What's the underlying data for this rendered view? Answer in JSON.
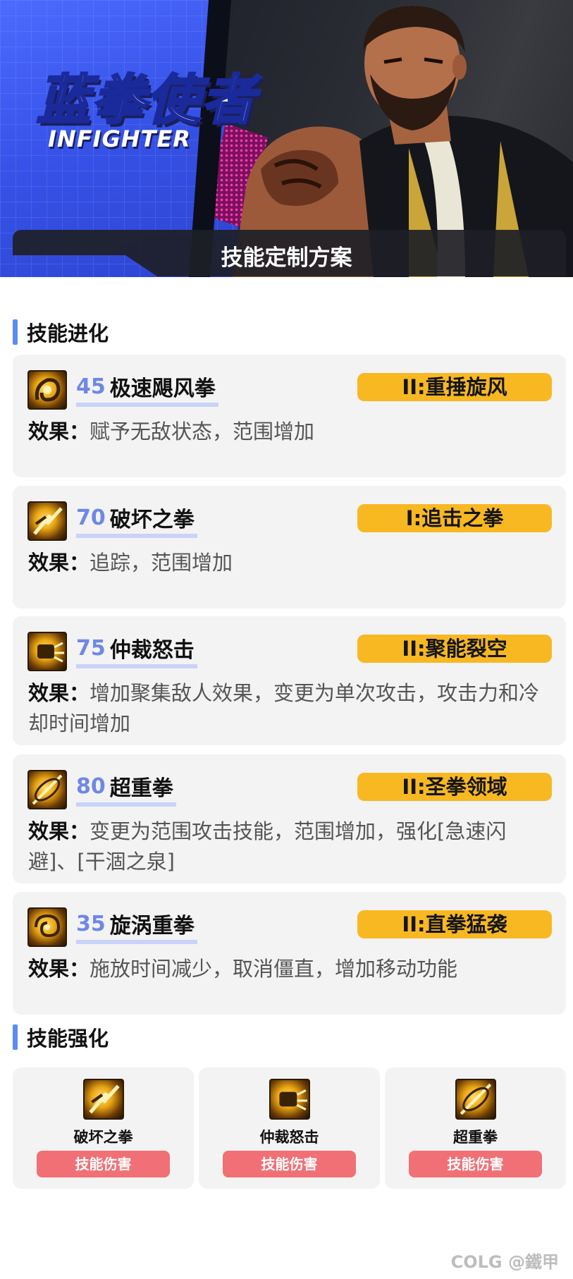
{
  "banner": {
    "title": "蓝拳使者",
    "subtitle": "INFIGHTER",
    "bar_title": "技能定制方案"
  },
  "sections": {
    "evolution": "技能进化",
    "enhance": "技能强化"
  },
  "effect_label": "效果：",
  "skills": [
    {
      "level": "45",
      "name": "极速飓风拳",
      "tag": "II:重捶旋风",
      "effect": "赋予无敌状态，范围增加",
      "icon": "whirlwind-fist-icon"
    },
    {
      "level": "70",
      "name": "破坏之拳",
      "tag": "I:追击之拳",
      "effect": "追踪，范围增加",
      "icon": "destruction-fist-icon"
    },
    {
      "level": "75",
      "name": "仲裁怒击",
      "tag": "II:聚能裂空",
      "effect": "增加聚集敌人效果，变更为单次攻击，攻击力和冷却时间增加",
      "icon": "arbitration-strike-icon"
    },
    {
      "level": "80",
      "name": "超重拳",
      "tag": "II:圣拳领域",
      "effect": "变更为范围攻击技能，范围增加，强化[急速闪避]、[干涸之泉]",
      "icon": "super-heavy-fist-icon"
    },
    {
      "level": "35",
      "name": "旋涡重拳",
      "tag": "II:直拳猛袭",
      "effect": "施放时间减少，取消僵直，增加移动功能",
      "icon": "vortex-fist-icon"
    }
  ],
  "enhancements": [
    {
      "name": "破坏之拳",
      "button": "技能伤害",
      "icon": "destruction-fist-icon"
    },
    {
      "name": "仲裁怒击",
      "button": "技能伤害",
      "icon": "arbitration-strike-icon"
    },
    {
      "name": "超重拳",
      "button": "技能伤害",
      "icon": "super-heavy-fist-icon"
    }
  ],
  "watermark": "COLG @鐵甲",
  "colors": {
    "accent_blue": "#5b8cf0",
    "level_blue": "#6f88e6",
    "tag_yellow": "#f8b822",
    "button_red": "#f07076",
    "card_bg": "#f3f3f4"
  }
}
